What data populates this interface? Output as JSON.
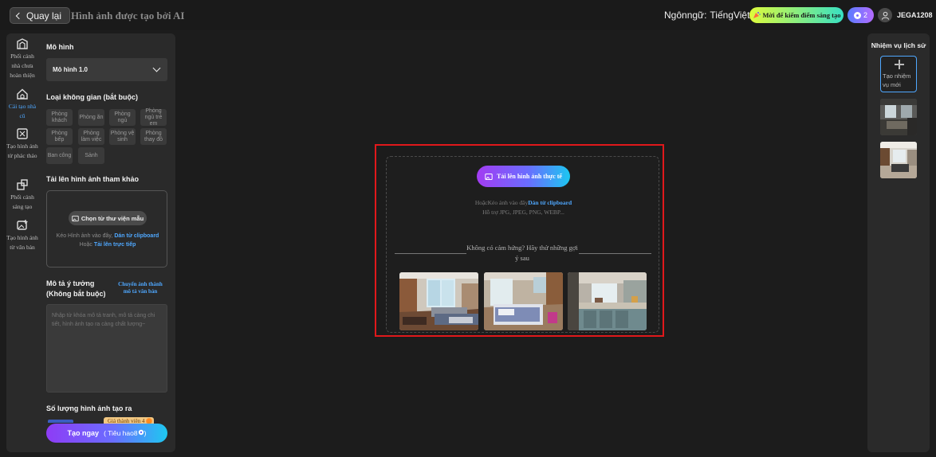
{
  "header": {
    "back_label": "Quay lại",
    "page_title": "Hình ảnh được tạo bởi AI",
    "language_label": "Ngônngữ:",
    "language_value": "TiếngViệt",
    "promo_label": "Mời để kiếm điểm sáng tạo",
    "credits_count": "2",
    "username": "JEGA1208"
  },
  "rail": {
    "items": [
      {
        "label": "Phối cảnh nhà chưa hoàn thiện",
        "icon": "building-icon"
      },
      {
        "label": "Cải tạo nhà cũ",
        "icon": "home-icon",
        "active": true
      },
      {
        "label": "Tạo hình ảnh từ phác thảo",
        "icon": "sketch-icon"
      },
      {
        "label": "Phối cảnh sáng tạo",
        "icon": "layers-icon"
      },
      {
        "label": "Tạo hình ảnh từ văn bản",
        "icon": "image-add-icon"
      }
    ]
  },
  "panel": {
    "model_label": "Mô hình",
    "model_value": "Mô hình 1.0",
    "space_label": "Loại không gian (bắt buộc)",
    "space_types": [
      "Phòng khách",
      "Phòng ăn",
      "Phòng ngủ",
      "Phòng ngủ trẻ em",
      "Phòng bếp",
      "Phòng làm việc",
      "Phòng vệ sinh",
      "Phòng thay đồ",
      "Ban công",
      "Sảnh"
    ],
    "reference_label": "Tải lên hình ảnh tham khảo",
    "reference_button": "Chọn từ thư viện mẫu",
    "reference_hint_prefix": "Kéo Hình ảnh vào đây,",
    "reference_hint_link1": "Dán từ clipboard",
    "reference_hint_mid": "Hoặc",
    "reference_hint_link2": "Tải lên trực tiếp",
    "idea_label": "Mô tả ý tưởng",
    "idea_sublabel": "(Không bắt buộc)",
    "idea_link": "Chuyển ảnh thành mô tả văn bản",
    "idea_placeholder": "Nhập từ khóa mô tả tranh, mô tả càng chi tiết, hình ảnh tạo ra càng chất lượng~",
    "count_label": "Số lượng hình ảnh tạo ra",
    "member_badge": "Giá thành viên 4",
    "create_label": "Tạo ngay",
    "create_cost": "( Tiêu hao8",
    "create_cost_suffix": ")"
  },
  "main": {
    "upload_button": "Tải lên hình ảnh thực tế",
    "drag_prefix": "HoặcKéo ảnh vào đây",
    "drag_link": "Dán từ clipboard",
    "formats": "Hỗ trợ JPG, JPEG, PNG, WEBP...",
    "suggest_text": "Không có cảm hứng? Hãy thử những gợi ý sau",
    "samples": [
      "living-room-sample",
      "bedroom-sample",
      "kitchen-sample"
    ]
  },
  "history": {
    "title": "Nhiệm vụ lịch sử",
    "new_task": "Tạo nhiệm vụ mới"
  },
  "colors": {
    "accent": "#4fa8ff",
    "highlight_border": "#e0181b",
    "panel_bg": "#2a2a2a",
    "page_bg": "#1c1c1c"
  }
}
